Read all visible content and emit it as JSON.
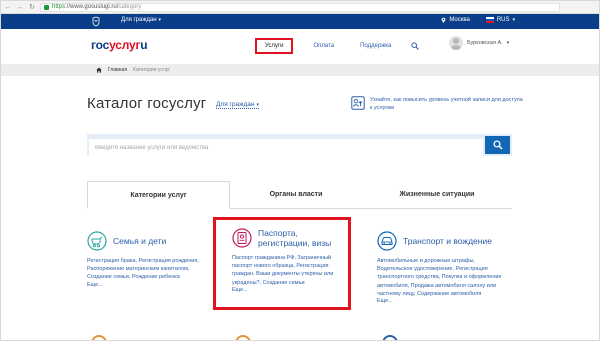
{
  "browser": {
    "url_scheme": "https",
    "url_rest": "://www.gosuslugi.ru/",
    "url_path": "category"
  },
  "top_bar": {
    "audience_menu": "Для граждан",
    "location": "Москва",
    "language": "RUS"
  },
  "header": {
    "logo": [
      "гос",
      "услуг",
      "u"
    ],
    "nav": {
      "services": "Услуги",
      "payment": "Оплата",
      "support": "Поддержка"
    },
    "user_name": "Бурковская А."
  },
  "breadcrumb": {
    "home": "Главная",
    "current": "Категории услуг"
  },
  "page": {
    "title": "Каталог госуслуг",
    "audience_select": "Для граждан",
    "upgrade_hint": "Узнайте, как повысить уровень учетной записи для доступа к услугам"
  },
  "search": {
    "placeholder": "Введите название услуги или ведомства"
  },
  "tabs": {
    "categories": "Категории услуг",
    "authorities": "Органы власти",
    "life_situations": "Жизненные ситуации"
  },
  "categories": {
    "family": {
      "title": "Семья и дети",
      "desc": "Регистрация брака, Регистрация рождения, Распоряжение материнским капиталом, Создание семьи, Рождение ребенка",
      "more": "Еще..."
    },
    "passport": {
      "title": "Паспорта, регистрации, визы",
      "desc": "Паспорт гражданина РФ, Заграничный паспорт нового образца, Регистрация граждан, Ваши документы утеряны или украдены?, Создание семьи",
      "more": "Еще..."
    },
    "transport": {
      "title": "Транспорт и вождение",
      "desc": "Автомобильные и дорожные штрафы, Водительское удостоверение, Регистрация транспортного средства, Покупка и оформление автомобиля, Продажа автомобиля салону или частному лицу, Содержание автомобиля",
      "more": "Еще..."
    }
  },
  "colors": {
    "brand_blue": "#0b3e88",
    "link_blue": "#2b5faa",
    "highlight_red": "#e0141e",
    "search_button": "#1266b6"
  }
}
